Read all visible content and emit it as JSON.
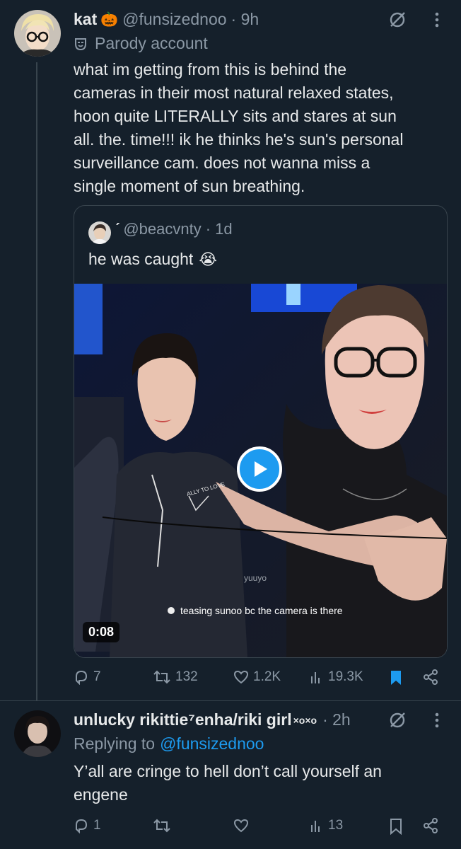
{
  "tweet1": {
    "display_name": "kat",
    "emoji": "🎃",
    "handle": "@funsizednoo",
    "time": "· 9h",
    "parody_label": "Parody account",
    "text_lines": [
      "what im getting from this is behind the",
      "cameras in their most natural relaxed states,",
      "hoon quite LITERALLY sits and stares at sun",
      "all. the. time!!! ik he thinks he's sun's personal",
      "surveillance cam. does not wanna miss a",
      "single moment of sun breathing."
    ],
    "quote": {
      "name_mark": "ˊ",
      "handle": "@beacvnty",
      "time": "· 1d",
      "text": "he was caught",
      "emoji": "😭",
      "video": {
        "watermark": "yuuyo",
        "caption": "teasing sunoo bc the camera is there",
        "duration": "0:08",
        "jacket_text": "ALLY TO LOVE"
      }
    },
    "stats": {
      "replies": "7",
      "reposts": "132",
      "likes": "1.2K",
      "views": "19.3K"
    }
  },
  "tweet2": {
    "display_name": "unlucky rikittie⁷enha/riki girl",
    "name_suffix": "×o×o",
    "time": "· 2h",
    "replying_prefix": "Replying to",
    "replying_to": "@funsizednoo",
    "text_lines": [
      "Y’all are cringe to hell don’t call yourself an",
      "engene"
    ],
    "stats": {
      "replies": "1",
      "reposts": "",
      "likes": "",
      "views": "13"
    }
  },
  "colors": {
    "background": "#15202b",
    "text": "#e7e9ea",
    "muted": "#8b98a5",
    "accent": "#1d9bf0",
    "divider": "#38444d"
  },
  "icons": [
    "grok-slash-icon",
    "more-vertical-icon",
    "parody-mask-icon",
    "reply-icon",
    "repost-icon",
    "like-icon",
    "views-icon",
    "bookmark-icon",
    "share-icon",
    "play-icon"
  ]
}
